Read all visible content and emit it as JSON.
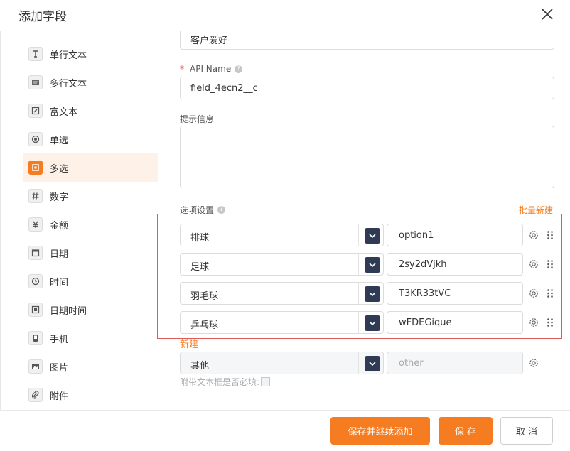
{
  "dialog": {
    "title": "添加字段"
  },
  "sidebar": {
    "items": [
      {
        "label": "单行文本",
        "icon": "single-line-text-icon"
      },
      {
        "label": "多行文本",
        "icon": "multi-line-text-icon"
      },
      {
        "label": "富文本",
        "icon": "rich-text-icon"
      },
      {
        "label": "单选",
        "icon": "radio-icon"
      },
      {
        "label": "多选",
        "icon": "checkbox-icon",
        "active": true
      },
      {
        "label": "数字",
        "icon": "hash-icon"
      },
      {
        "label": "金额",
        "icon": "currency-icon"
      },
      {
        "label": "日期",
        "icon": "date-icon"
      },
      {
        "label": "时间",
        "icon": "clock-icon"
      },
      {
        "label": "日期时间",
        "icon": "datetime-icon"
      },
      {
        "label": "手机",
        "icon": "phone-icon"
      },
      {
        "label": "图片",
        "icon": "image-icon"
      },
      {
        "label": "附件",
        "icon": "attachment-icon"
      }
    ]
  },
  "form": {
    "name_value": "客户爱好",
    "api_name_label": "API Name",
    "api_name_value": "field_4ecn2__c",
    "hint_label": "提示信息",
    "hint_value": "",
    "options_label": "选项设置",
    "batch_new_label": "批量新建",
    "options": [
      {
        "label": "排球",
        "value": "option1"
      },
      {
        "label": "足球",
        "value": "2sy2dVjkh"
      },
      {
        "label": "羽毛球",
        "value": "T3KR33tVC"
      },
      {
        "label": "乒乓球",
        "value": "wFDEGique"
      }
    ],
    "new_label": "新建",
    "other": {
      "label": "其他",
      "value_placeholder": "other"
    },
    "attach_required_label": "附带文本框是否必填:"
  },
  "footer": {
    "save_continue_label": "保存并继续添加",
    "save_label": "保 存",
    "cancel_label": "取 消"
  },
  "colors": {
    "accent": "#f57c20",
    "dropdown": "#2f3a55",
    "highlight_border": "#e05a5a",
    "active_bg": "#fdf1e8"
  }
}
